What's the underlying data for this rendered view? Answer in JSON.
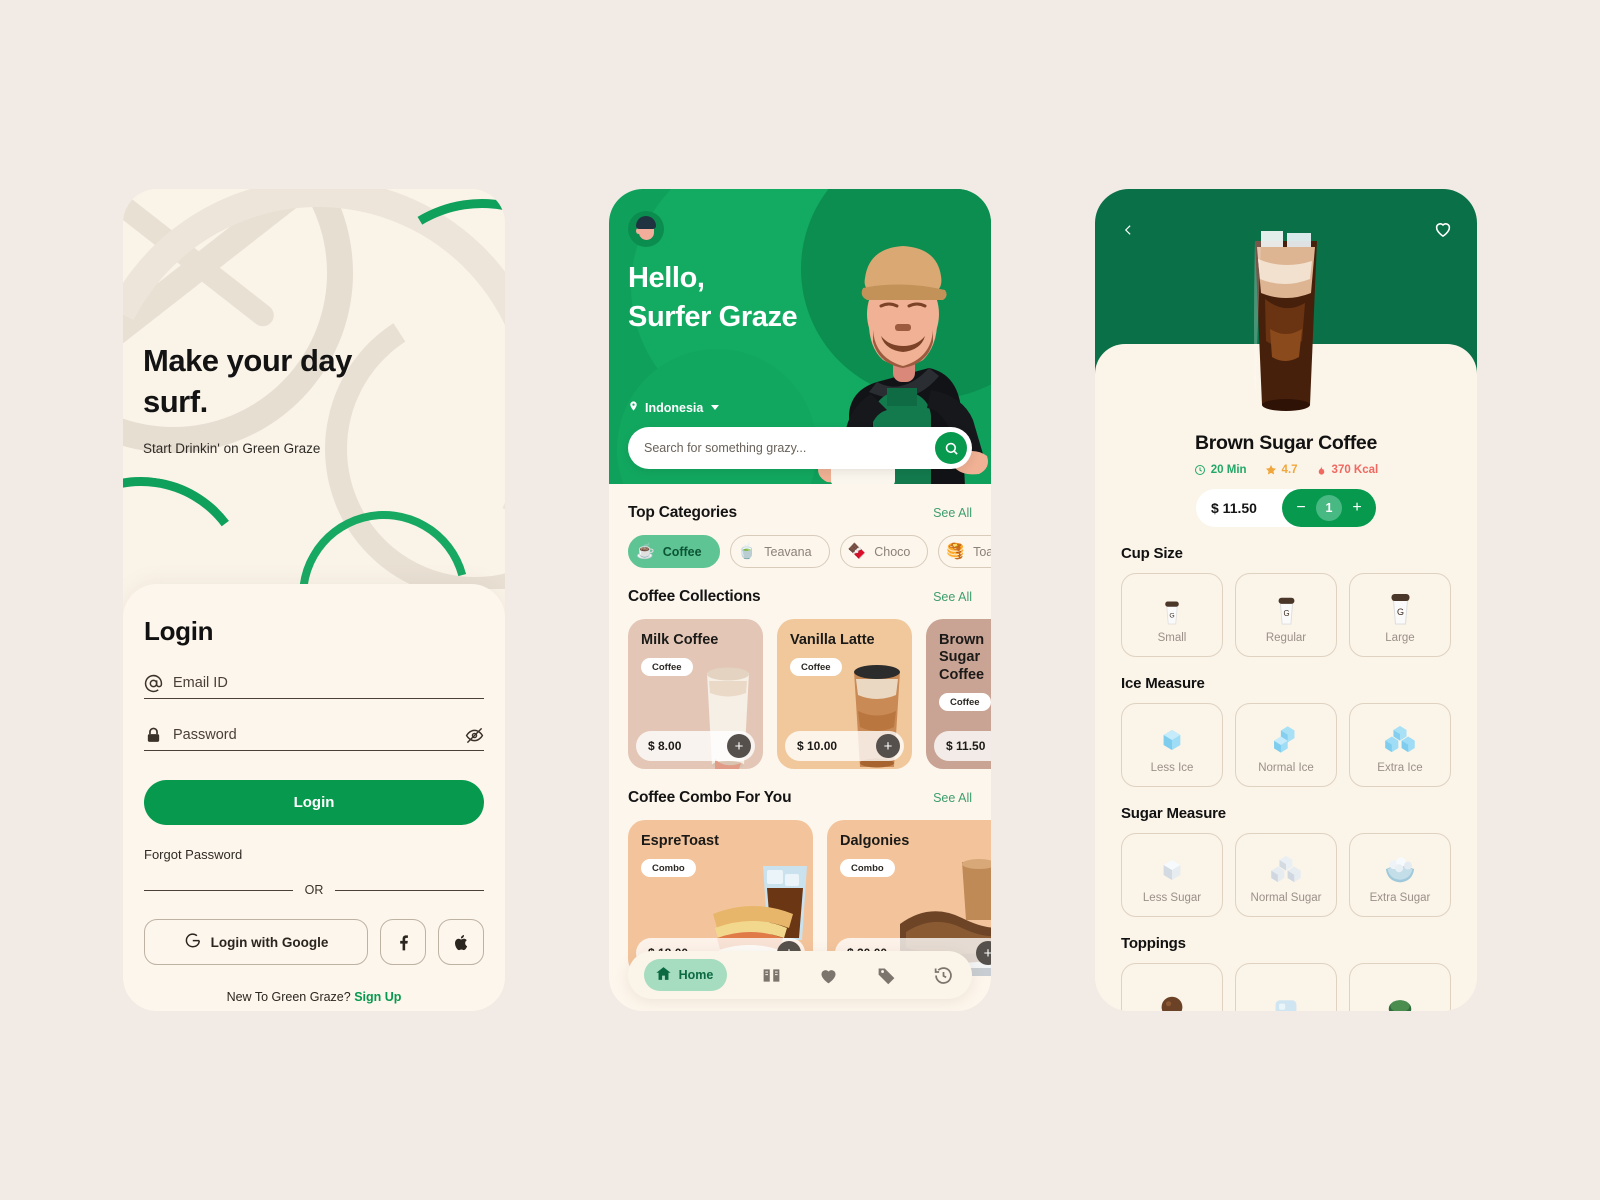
{
  "theme": {
    "page_bg": "#F2EBE5",
    "brand_green": "#079A4E",
    "header_green": "#0FA05B",
    "detail_green": "#0A7048",
    "card_cream": "#FBF4E9"
  },
  "login_screen": {
    "hero": {
      "title": "Make your day surf.",
      "subtitle": "Start Drinkin' on Green Graze"
    },
    "heading": "Login",
    "email": {
      "label": "email-id",
      "placeholder": "Email ID",
      "value": ""
    },
    "password": {
      "label": "password",
      "placeholder": "Password",
      "value": ""
    },
    "login_button": "Login",
    "forgot_password": "Forgot Password",
    "divider": "OR",
    "google_button": "Login with Google",
    "facebook_button": "f",
    "apple_button": "apple",
    "signup_prompt": "New To Green Graze?",
    "signup_link": "Sign Up"
  },
  "home_screen": {
    "greeting_line1": "Hello,",
    "greeting_line2": "Surfer Graze",
    "location": "Indonesia",
    "search_placeholder": "Search for something grazy...",
    "search_value": "",
    "sections": {
      "categories": {
        "title": "Top Categories",
        "see_all": "See All"
      },
      "collections": {
        "title": "Coffee Collections",
        "see_all": "See All"
      },
      "combos": {
        "title": "Coffee Combo For You",
        "see_all": "See All"
      }
    },
    "categories": [
      {
        "label": "Coffee",
        "emoji": "☕",
        "active": true
      },
      {
        "label": "Teavana",
        "emoji": "🍵",
        "active": false
      },
      {
        "label": "Choco",
        "emoji": "🍫",
        "active": false
      },
      {
        "label": "Toast",
        "emoji": "🥞",
        "active": false
      }
    ],
    "collections": [
      {
        "name": "Milk Coffee",
        "tag": "Coffee",
        "price": "$ 8.00",
        "bg": "#E3C6B6"
      },
      {
        "name": "Vanilla Latte",
        "tag": "Coffee",
        "price": "$ 10.00",
        "bg": "#F0C89C"
      },
      {
        "name": "Brown Sugar Coffee",
        "tag": "Coffee",
        "price": "$ 11.50",
        "bg": "#C9A394"
      }
    ],
    "combos": [
      {
        "name": "EspreToast",
        "tag": "Combo",
        "price": "$ 18.00",
        "bg": "#F3C49B"
      },
      {
        "name": "Dalgonies",
        "tag": "Combo",
        "price": "$ 20.00",
        "bg": "#F3C49B"
      }
    ],
    "nav": [
      {
        "name": "home",
        "label": "Home",
        "active": true
      },
      {
        "name": "menu",
        "label": "",
        "active": false
      },
      {
        "name": "favorite",
        "label": "",
        "active": false
      },
      {
        "name": "offers",
        "label": "",
        "active": false
      },
      {
        "name": "history",
        "label": "",
        "active": false
      }
    ]
  },
  "detail_screen": {
    "product_name": "Brown Sugar Coffee",
    "time": "20 Min",
    "rating": "4.7",
    "calories": "370 Kcal",
    "price": "$ 11.50",
    "quantity": "1",
    "qty_minus": "−",
    "qty_plus": "+",
    "cup_size": {
      "title": "Cup Size",
      "options": [
        {
          "label": "Small",
          "size": "sm"
        },
        {
          "label": "Regular",
          "size": "md"
        },
        {
          "label": "Large",
          "size": "lg"
        }
      ]
    },
    "ice_measure": {
      "title": "Ice Measure",
      "options": [
        {
          "label": "Less Ice",
          "count": 1
        },
        {
          "label": "Normal Ice",
          "count": 2
        },
        {
          "label": "Extra Ice",
          "count": 3
        }
      ]
    },
    "sugar_measure": {
      "title": "Sugar Measure",
      "options": [
        {
          "label": "Less Sugar",
          "kind": "cube"
        },
        {
          "label": "Normal Sugar",
          "kind": "stack"
        },
        {
          "label": "Extra Sugar",
          "kind": "bowl"
        }
      ]
    },
    "toppings": {
      "title": "Toppings",
      "options": [
        {
          "label": ""
        },
        {
          "label": ""
        },
        {
          "label": ""
        }
      ]
    }
  }
}
